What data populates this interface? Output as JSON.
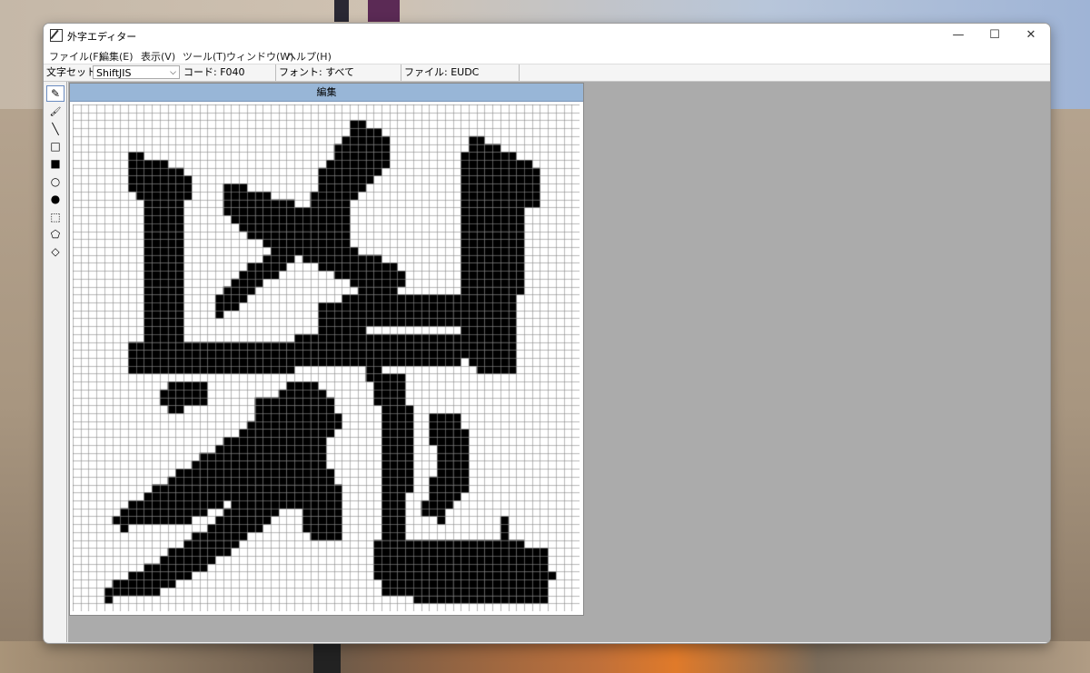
{
  "window": {
    "title": "外字エディター",
    "minimize_glyph": "—",
    "maximize_glyph": "☐",
    "close_glyph": "✕"
  },
  "menu": {
    "items": [
      "ファイル(F)",
      "編集(E)",
      "表示(V)",
      "ツール(T)",
      "ウィンドウ(W)",
      "ヘルプ(H)"
    ]
  },
  "status": {
    "charset_label": "文字セット:",
    "charset_value": "ShiftJIS",
    "code": "コード: F040",
    "font": "フォント: すべて",
    "file": "ファイル: EUDC"
  },
  "tools": [
    {
      "name": "pencil-icon",
      "glyph": "✎"
    },
    {
      "name": "brush-icon",
      "glyph": "🖌"
    },
    {
      "name": "line-icon",
      "glyph": "╲"
    },
    {
      "name": "hollow-rectangle-icon",
      "glyph": "□"
    },
    {
      "name": "filled-rectangle-icon",
      "glyph": "■"
    },
    {
      "name": "hollow-ellipse-icon",
      "glyph": "○"
    },
    {
      "name": "filled-ellipse-icon",
      "glyph": "●"
    },
    {
      "name": "rectangular-selection-icon",
      "glyph": "⬚"
    },
    {
      "name": "freeform-selection-icon",
      "glyph": "⬠"
    },
    {
      "name": "eraser-icon",
      "glyph": "◇"
    }
  ],
  "editor": {
    "header": "編集",
    "grid_cols": 64,
    "grid_rows": 64,
    "ink_color": "#000000",
    "paper_color": "#ffffff",
    "gridline_color": "#8a8a8a"
  }
}
